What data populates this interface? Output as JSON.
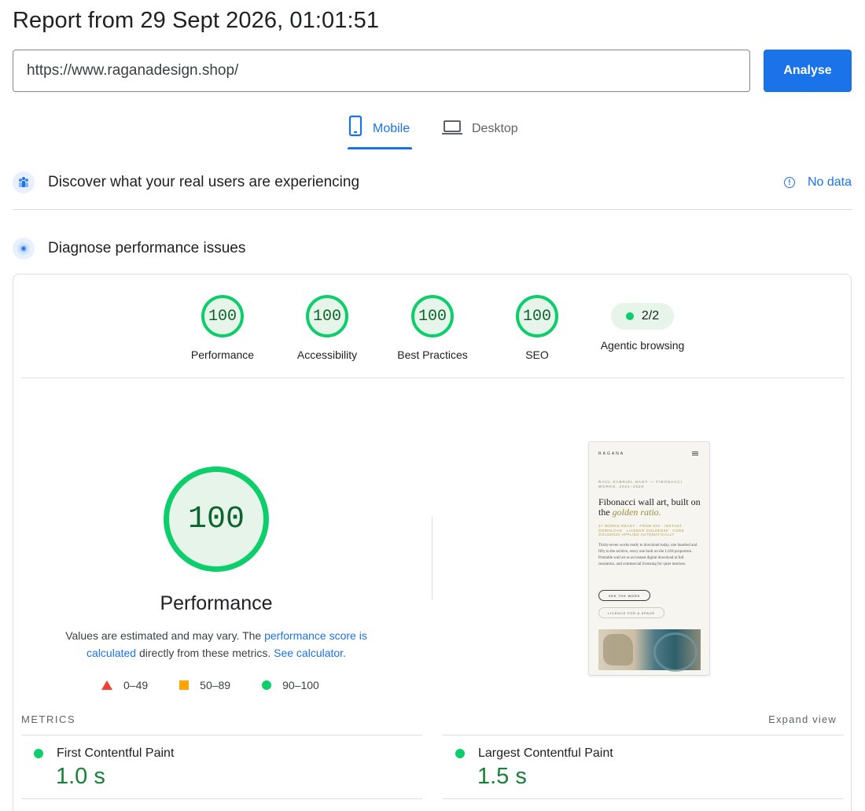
{
  "report": {
    "title": "Report from 29 Sept 2026, 01:01:51",
    "url_value": "https://www.raganadesign.shop/",
    "analyse_label": "Analyse"
  },
  "tabs": [
    {
      "label": "Mobile",
      "icon": "phone-icon",
      "active": true
    },
    {
      "label": "Desktop",
      "icon": "laptop-icon",
      "active": false
    }
  ],
  "sections": {
    "discover": {
      "title": "Discover what your real users are experiencing",
      "no_data": "No data"
    },
    "diagnose": {
      "title": "Diagnose performance issues"
    }
  },
  "scores": [
    {
      "label": "Performance",
      "value": "100"
    },
    {
      "label": "Accessibility",
      "value": "100"
    },
    {
      "label": "Best Practices",
      "value": "100"
    },
    {
      "label": "SEO",
      "value": "100"
    }
  ],
  "agentic": {
    "label": "Agentic browsing",
    "value": "2/2"
  },
  "main_gauge": {
    "value": "100",
    "label": "Performance",
    "desc_prefix": "Values are estimated and may vary. The ",
    "desc_link1": "performance score is calculated",
    "desc_mid": " directly from these metrics. ",
    "desc_link2": "See calculator."
  },
  "legend": [
    {
      "range": "0–49",
      "shape": "triangle",
      "color": "#eb4335"
    },
    {
      "range": "50–89",
      "shape": "square",
      "color": "#ffa400"
    },
    {
      "range": "90–100",
      "shape": "circle",
      "color": "#0cce6b"
    }
  ],
  "preview": {
    "brand": "RAGANA",
    "eyebrow": "RAUL GABRIEL NAGY — FIBONACCI WORKS, 2021–2026",
    "headline_plain": "Fibonacci wall art, built on the ",
    "headline_em": "golden ratio.",
    "gold_line": "37 WORKS READY · FROM €24 · INSTANT DOWNLOAD · LICENCE GOLDEN20 · CODE GOLDEN20 APPLIED AUTOMATICALLY",
    "body": "Thirty-seven works ready to download today, one hundred and fifty in the archive, every one built on the 1.618 proportion. Printable wall art as an instant digital download at full resolution, and commercial licensing for quiet interiors.",
    "btn1": "SEE THE WORK",
    "btn2": "LICENCE FOR A SPACE"
  },
  "metrics": {
    "label": "METRICS",
    "expand": "Expand view",
    "items": [
      {
        "name": "First Contentful Paint",
        "value": "1.0 s"
      },
      {
        "name": "Largest Contentful Paint",
        "value": "1.5 s"
      }
    ]
  },
  "colors": {
    "accent": "#1a73e8",
    "pass": "#0cce6b",
    "pass_text": "#0d652d",
    "pass_bg": "#e6f4ea"
  }
}
